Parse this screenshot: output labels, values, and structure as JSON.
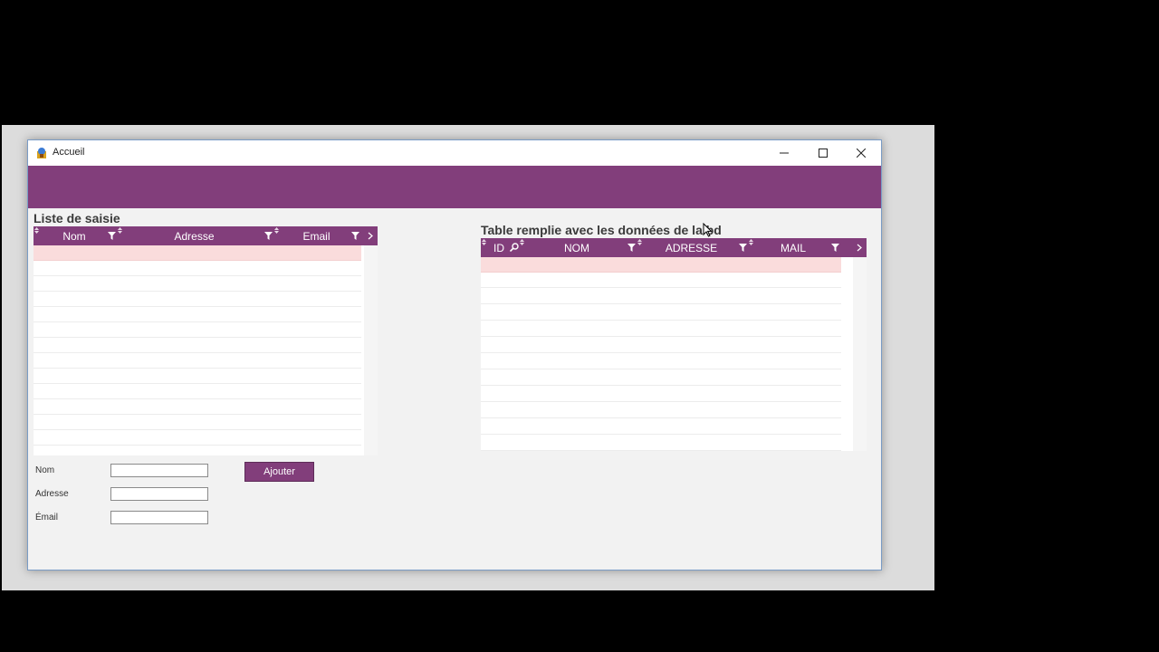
{
  "window": {
    "title": "Accueil"
  },
  "left_panel": {
    "title": "Liste de saisie",
    "columns": [
      "Nom",
      "Adresse",
      "Email"
    ]
  },
  "right_panel": {
    "title": "Table remplie avec les données de la bd",
    "columns": [
      "ID",
      "NOM",
      "ADRESSE",
      "MAIL"
    ]
  },
  "form": {
    "nom_label": "Nom",
    "adresse_label": "Adresse",
    "email_label": "Émail",
    "nom_value": "",
    "adresse_value": "",
    "email_value": "",
    "submit_label": "Ajouter"
  },
  "colors": {
    "accent": "#823e7b",
    "selected_row": "#fadcdc"
  }
}
